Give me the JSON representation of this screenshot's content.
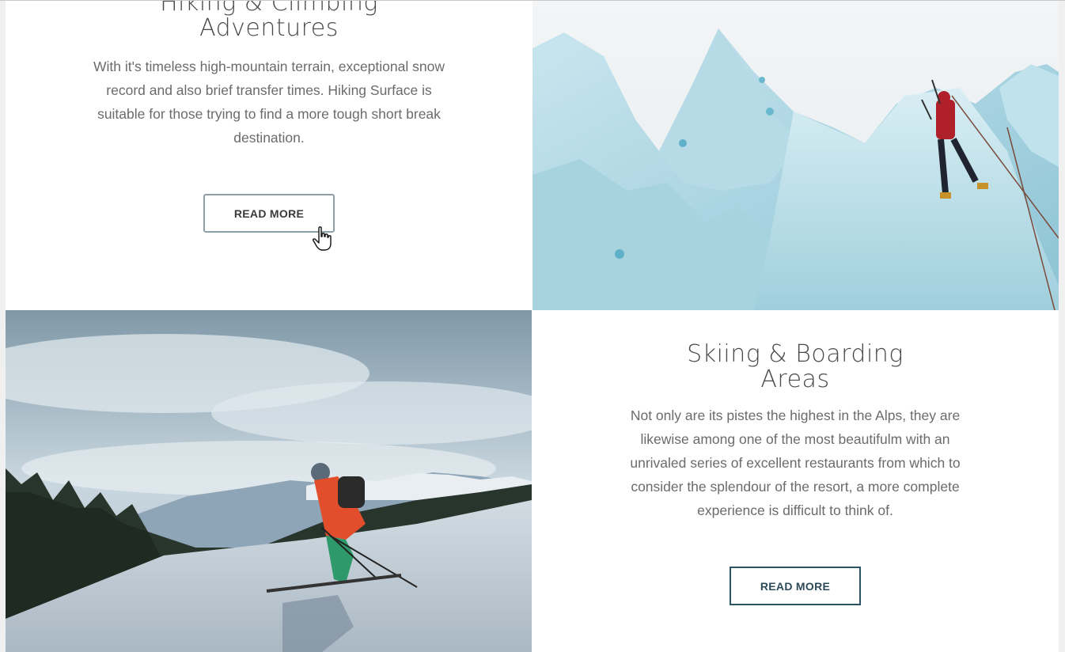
{
  "hiking": {
    "title_line1": "Hiking & Climbing",
    "title_line2": "Adventures",
    "body_lines": [
      "With it's timeless high-mountain terrain, exceptional snow",
      "record and also brief transfer times. Hiking Surface is",
      "suitable for those trying to find a more tough short break",
      "destination."
    ],
    "button_label": "READ MORE"
  },
  "skiing": {
    "title_line1": "Skiing & Boarding",
    "title_line2": "Areas",
    "body_lines": [
      "Not only are its pistes the highest in the Alps, they are",
      "likewise among one of the most beautifulm with an",
      "unrivaled series of excellent restaurants from which to",
      "consider the splendour of the resort, a more complete",
      "experience is difficult to think of."
    ],
    "button_label": "READ MORE"
  },
  "images": {
    "ice_climbing": "ice-climber-photo",
    "skier": "skier-photo"
  },
  "colors": {
    "button_border_light": "#8ea0a8",
    "button_border_dark": "#2c5463",
    "heading": "#4a4a4a",
    "body": "#6b6b6b"
  }
}
